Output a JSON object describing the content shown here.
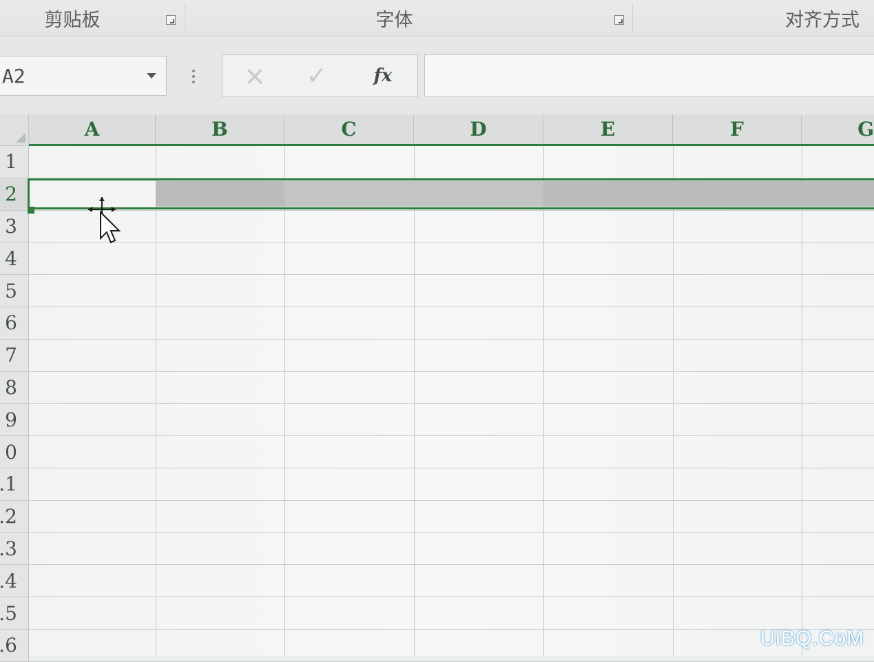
{
  "ribbon": {
    "groups": [
      {
        "label": "剪贴板"
      },
      {
        "label": "字体"
      },
      {
        "label": "对齐方式"
      }
    ]
  },
  "formula_bar": {
    "name_box_value": "A2",
    "cancel_icon": "×",
    "enter_icon": "✓",
    "insert_function_label": "fx",
    "formula_value": ""
  },
  "columns": [
    "A",
    "B",
    "C",
    "D",
    "E",
    "F",
    "G"
  ],
  "rows": [
    "1",
    "2",
    "3",
    "4",
    "5",
    "6",
    "7",
    "8",
    "9",
    "0",
    ".1",
    ".2",
    ".3",
    ".4",
    ".5",
    ".6"
  ],
  "selection": {
    "active_cell": "A2",
    "selected_row": "2"
  },
  "colors": {
    "accent": "#2f7d3e",
    "header_text": "#2f6b3b",
    "selection_fill": "#b9bcbb"
  },
  "watermark": "UiBQ.CoM"
}
